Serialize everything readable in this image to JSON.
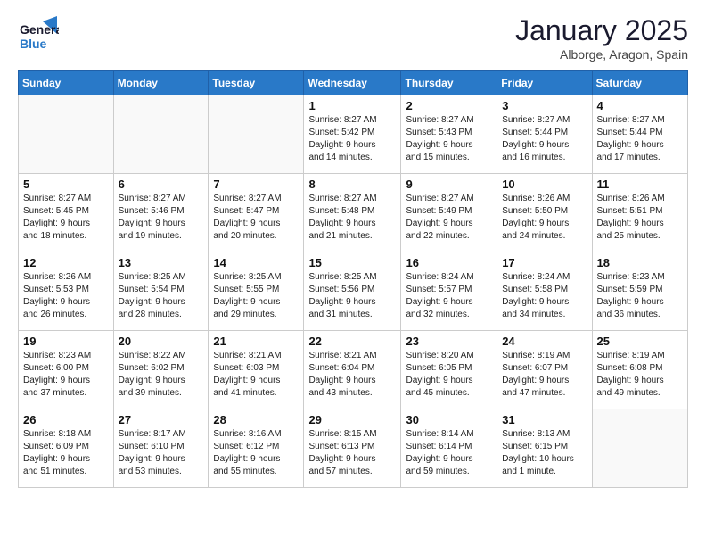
{
  "header": {
    "logo_general": "General",
    "logo_blue": "Blue",
    "month_title": "January 2025",
    "location": "Alborge, Aragon, Spain"
  },
  "weekdays": [
    "Sunday",
    "Monday",
    "Tuesday",
    "Wednesday",
    "Thursday",
    "Friday",
    "Saturday"
  ],
  "weeks": [
    [
      {
        "day": "",
        "info": ""
      },
      {
        "day": "",
        "info": ""
      },
      {
        "day": "",
        "info": ""
      },
      {
        "day": "1",
        "info": "Sunrise: 8:27 AM\nSunset: 5:42 PM\nDaylight: 9 hours\nand 14 minutes."
      },
      {
        "day": "2",
        "info": "Sunrise: 8:27 AM\nSunset: 5:43 PM\nDaylight: 9 hours\nand 15 minutes."
      },
      {
        "day": "3",
        "info": "Sunrise: 8:27 AM\nSunset: 5:44 PM\nDaylight: 9 hours\nand 16 minutes."
      },
      {
        "day": "4",
        "info": "Sunrise: 8:27 AM\nSunset: 5:44 PM\nDaylight: 9 hours\nand 17 minutes."
      }
    ],
    [
      {
        "day": "5",
        "info": "Sunrise: 8:27 AM\nSunset: 5:45 PM\nDaylight: 9 hours\nand 18 minutes."
      },
      {
        "day": "6",
        "info": "Sunrise: 8:27 AM\nSunset: 5:46 PM\nDaylight: 9 hours\nand 19 minutes."
      },
      {
        "day": "7",
        "info": "Sunrise: 8:27 AM\nSunset: 5:47 PM\nDaylight: 9 hours\nand 20 minutes."
      },
      {
        "day": "8",
        "info": "Sunrise: 8:27 AM\nSunset: 5:48 PM\nDaylight: 9 hours\nand 21 minutes."
      },
      {
        "day": "9",
        "info": "Sunrise: 8:27 AM\nSunset: 5:49 PM\nDaylight: 9 hours\nand 22 minutes."
      },
      {
        "day": "10",
        "info": "Sunrise: 8:26 AM\nSunset: 5:50 PM\nDaylight: 9 hours\nand 24 minutes."
      },
      {
        "day": "11",
        "info": "Sunrise: 8:26 AM\nSunset: 5:51 PM\nDaylight: 9 hours\nand 25 minutes."
      }
    ],
    [
      {
        "day": "12",
        "info": "Sunrise: 8:26 AM\nSunset: 5:53 PM\nDaylight: 9 hours\nand 26 minutes."
      },
      {
        "day": "13",
        "info": "Sunrise: 8:25 AM\nSunset: 5:54 PM\nDaylight: 9 hours\nand 28 minutes."
      },
      {
        "day": "14",
        "info": "Sunrise: 8:25 AM\nSunset: 5:55 PM\nDaylight: 9 hours\nand 29 minutes."
      },
      {
        "day": "15",
        "info": "Sunrise: 8:25 AM\nSunset: 5:56 PM\nDaylight: 9 hours\nand 31 minutes."
      },
      {
        "day": "16",
        "info": "Sunrise: 8:24 AM\nSunset: 5:57 PM\nDaylight: 9 hours\nand 32 minutes."
      },
      {
        "day": "17",
        "info": "Sunrise: 8:24 AM\nSunset: 5:58 PM\nDaylight: 9 hours\nand 34 minutes."
      },
      {
        "day": "18",
        "info": "Sunrise: 8:23 AM\nSunset: 5:59 PM\nDaylight: 9 hours\nand 36 minutes."
      }
    ],
    [
      {
        "day": "19",
        "info": "Sunrise: 8:23 AM\nSunset: 6:00 PM\nDaylight: 9 hours\nand 37 minutes."
      },
      {
        "day": "20",
        "info": "Sunrise: 8:22 AM\nSunset: 6:02 PM\nDaylight: 9 hours\nand 39 minutes."
      },
      {
        "day": "21",
        "info": "Sunrise: 8:21 AM\nSunset: 6:03 PM\nDaylight: 9 hours\nand 41 minutes."
      },
      {
        "day": "22",
        "info": "Sunrise: 8:21 AM\nSunset: 6:04 PM\nDaylight: 9 hours\nand 43 minutes."
      },
      {
        "day": "23",
        "info": "Sunrise: 8:20 AM\nSunset: 6:05 PM\nDaylight: 9 hours\nand 45 minutes."
      },
      {
        "day": "24",
        "info": "Sunrise: 8:19 AM\nSunset: 6:07 PM\nDaylight: 9 hours\nand 47 minutes."
      },
      {
        "day": "25",
        "info": "Sunrise: 8:19 AM\nSunset: 6:08 PM\nDaylight: 9 hours\nand 49 minutes."
      }
    ],
    [
      {
        "day": "26",
        "info": "Sunrise: 8:18 AM\nSunset: 6:09 PM\nDaylight: 9 hours\nand 51 minutes."
      },
      {
        "day": "27",
        "info": "Sunrise: 8:17 AM\nSunset: 6:10 PM\nDaylight: 9 hours\nand 53 minutes."
      },
      {
        "day": "28",
        "info": "Sunrise: 8:16 AM\nSunset: 6:12 PM\nDaylight: 9 hours\nand 55 minutes."
      },
      {
        "day": "29",
        "info": "Sunrise: 8:15 AM\nSunset: 6:13 PM\nDaylight: 9 hours\nand 57 minutes."
      },
      {
        "day": "30",
        "info": "Sunrise: 8:14 AM\nSunset: 6:14 PM\nDaylight: 9 hours\nand 59 minutes."
      },
      {
        "day": "31",
        "info": "Sunrise: 8:13 AM\nSunset: 6:15 PM\nDaylight: 10 hours\nand 1 minute."
      },
      {
        "day": "",
        "info": ""
      }
    ]
  ]
}
